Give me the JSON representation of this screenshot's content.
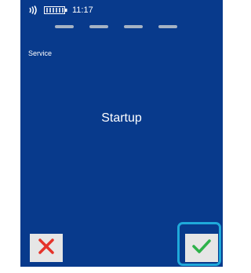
{
  "status_bar": {
    "time": "11:17",
    "contactless_icon": "contactless-icon",
    "battery_icon": "battery-icon"
  },
  "menu": {
    "label": "Service"
  },
  "screen": {
    "title": "Startup"
  },
  "soft_keys": {
    "cancel_icon": "close-icon",
    "confirm_icon": "checkmark-icon"
  },
  "colors": {
    "screen_background": "#083a8c",
    "cancel": "#e5332a",
    "confirm": "#2db24a",
    "focus_ring": "#1fa9da",
    "dash": "#a5b2c4"
  }
}
